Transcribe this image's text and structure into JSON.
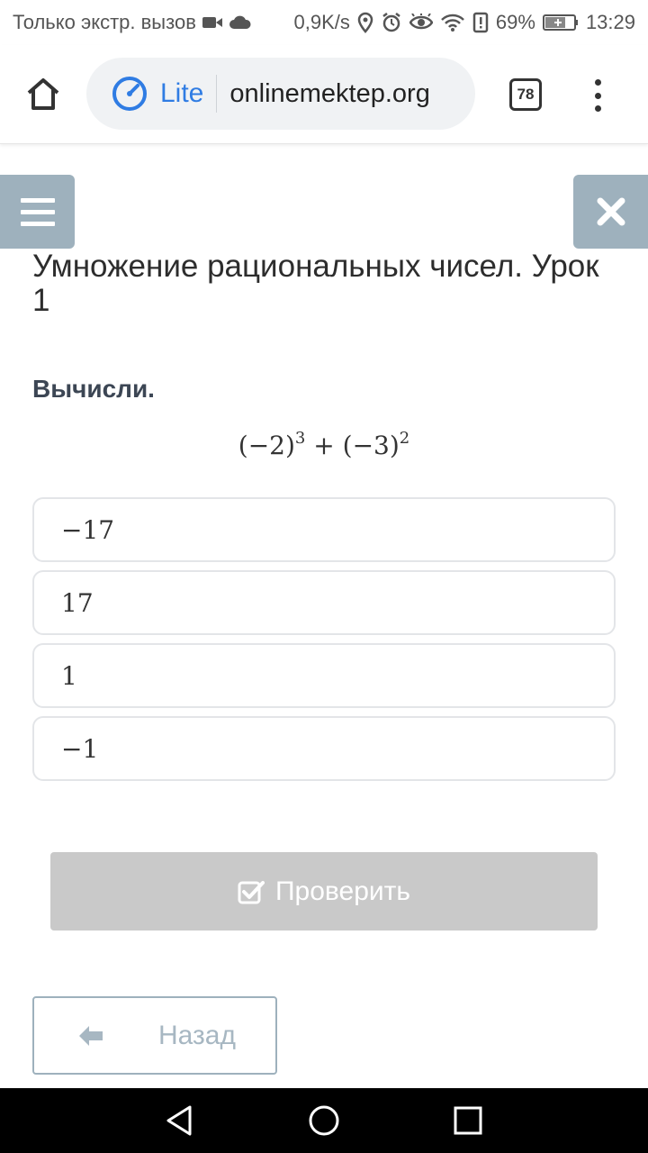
{
  "status_bar": {
    "carrier_text": "Только экстр. вызов",
    "net_speed": "0,9K/s",
    "battery": "69%",
    "time": "13:29",
    "icons": [
      "video-icon",
      "cloud-icon",
      "location-icon",
      "alarm-icon",
      "eye-icon",
      "wifi-icon",
      "alert-icon",
      "battery-icon"
    ]
  },
  "browser": {
    "lite_label": "Lite",
    "url": "onlinemektep.org",
    "tab_count": "78",
    "accent_color": "#2f7ce3"
  },
  "lesson": {
    "title": "Умножение рациональных чисел. Урок 1"
  },
  "question": {
    "instruction": "Вычисли.",
    "formula_a": "(−2)",
    "formula_a_exp": "3",
    "formula_op": "+",
    "formula_b": "(−3)",
    "formula_b_exp": "2"
  },
  "options": [
    {
      "label": "−17"
    },
    {
      "label": "17"
    },
    {
      "label": "1"
    },
    {
      "label": "−1"
    }
  ],
  "actions": {
    "check_label": "Проверить",
    "back_label": "Назад"
  },
  "colors": {
    "control_blue_gray": "#9eb1bd",
    "disabled_button": "#c9c9c9"
  }
}
